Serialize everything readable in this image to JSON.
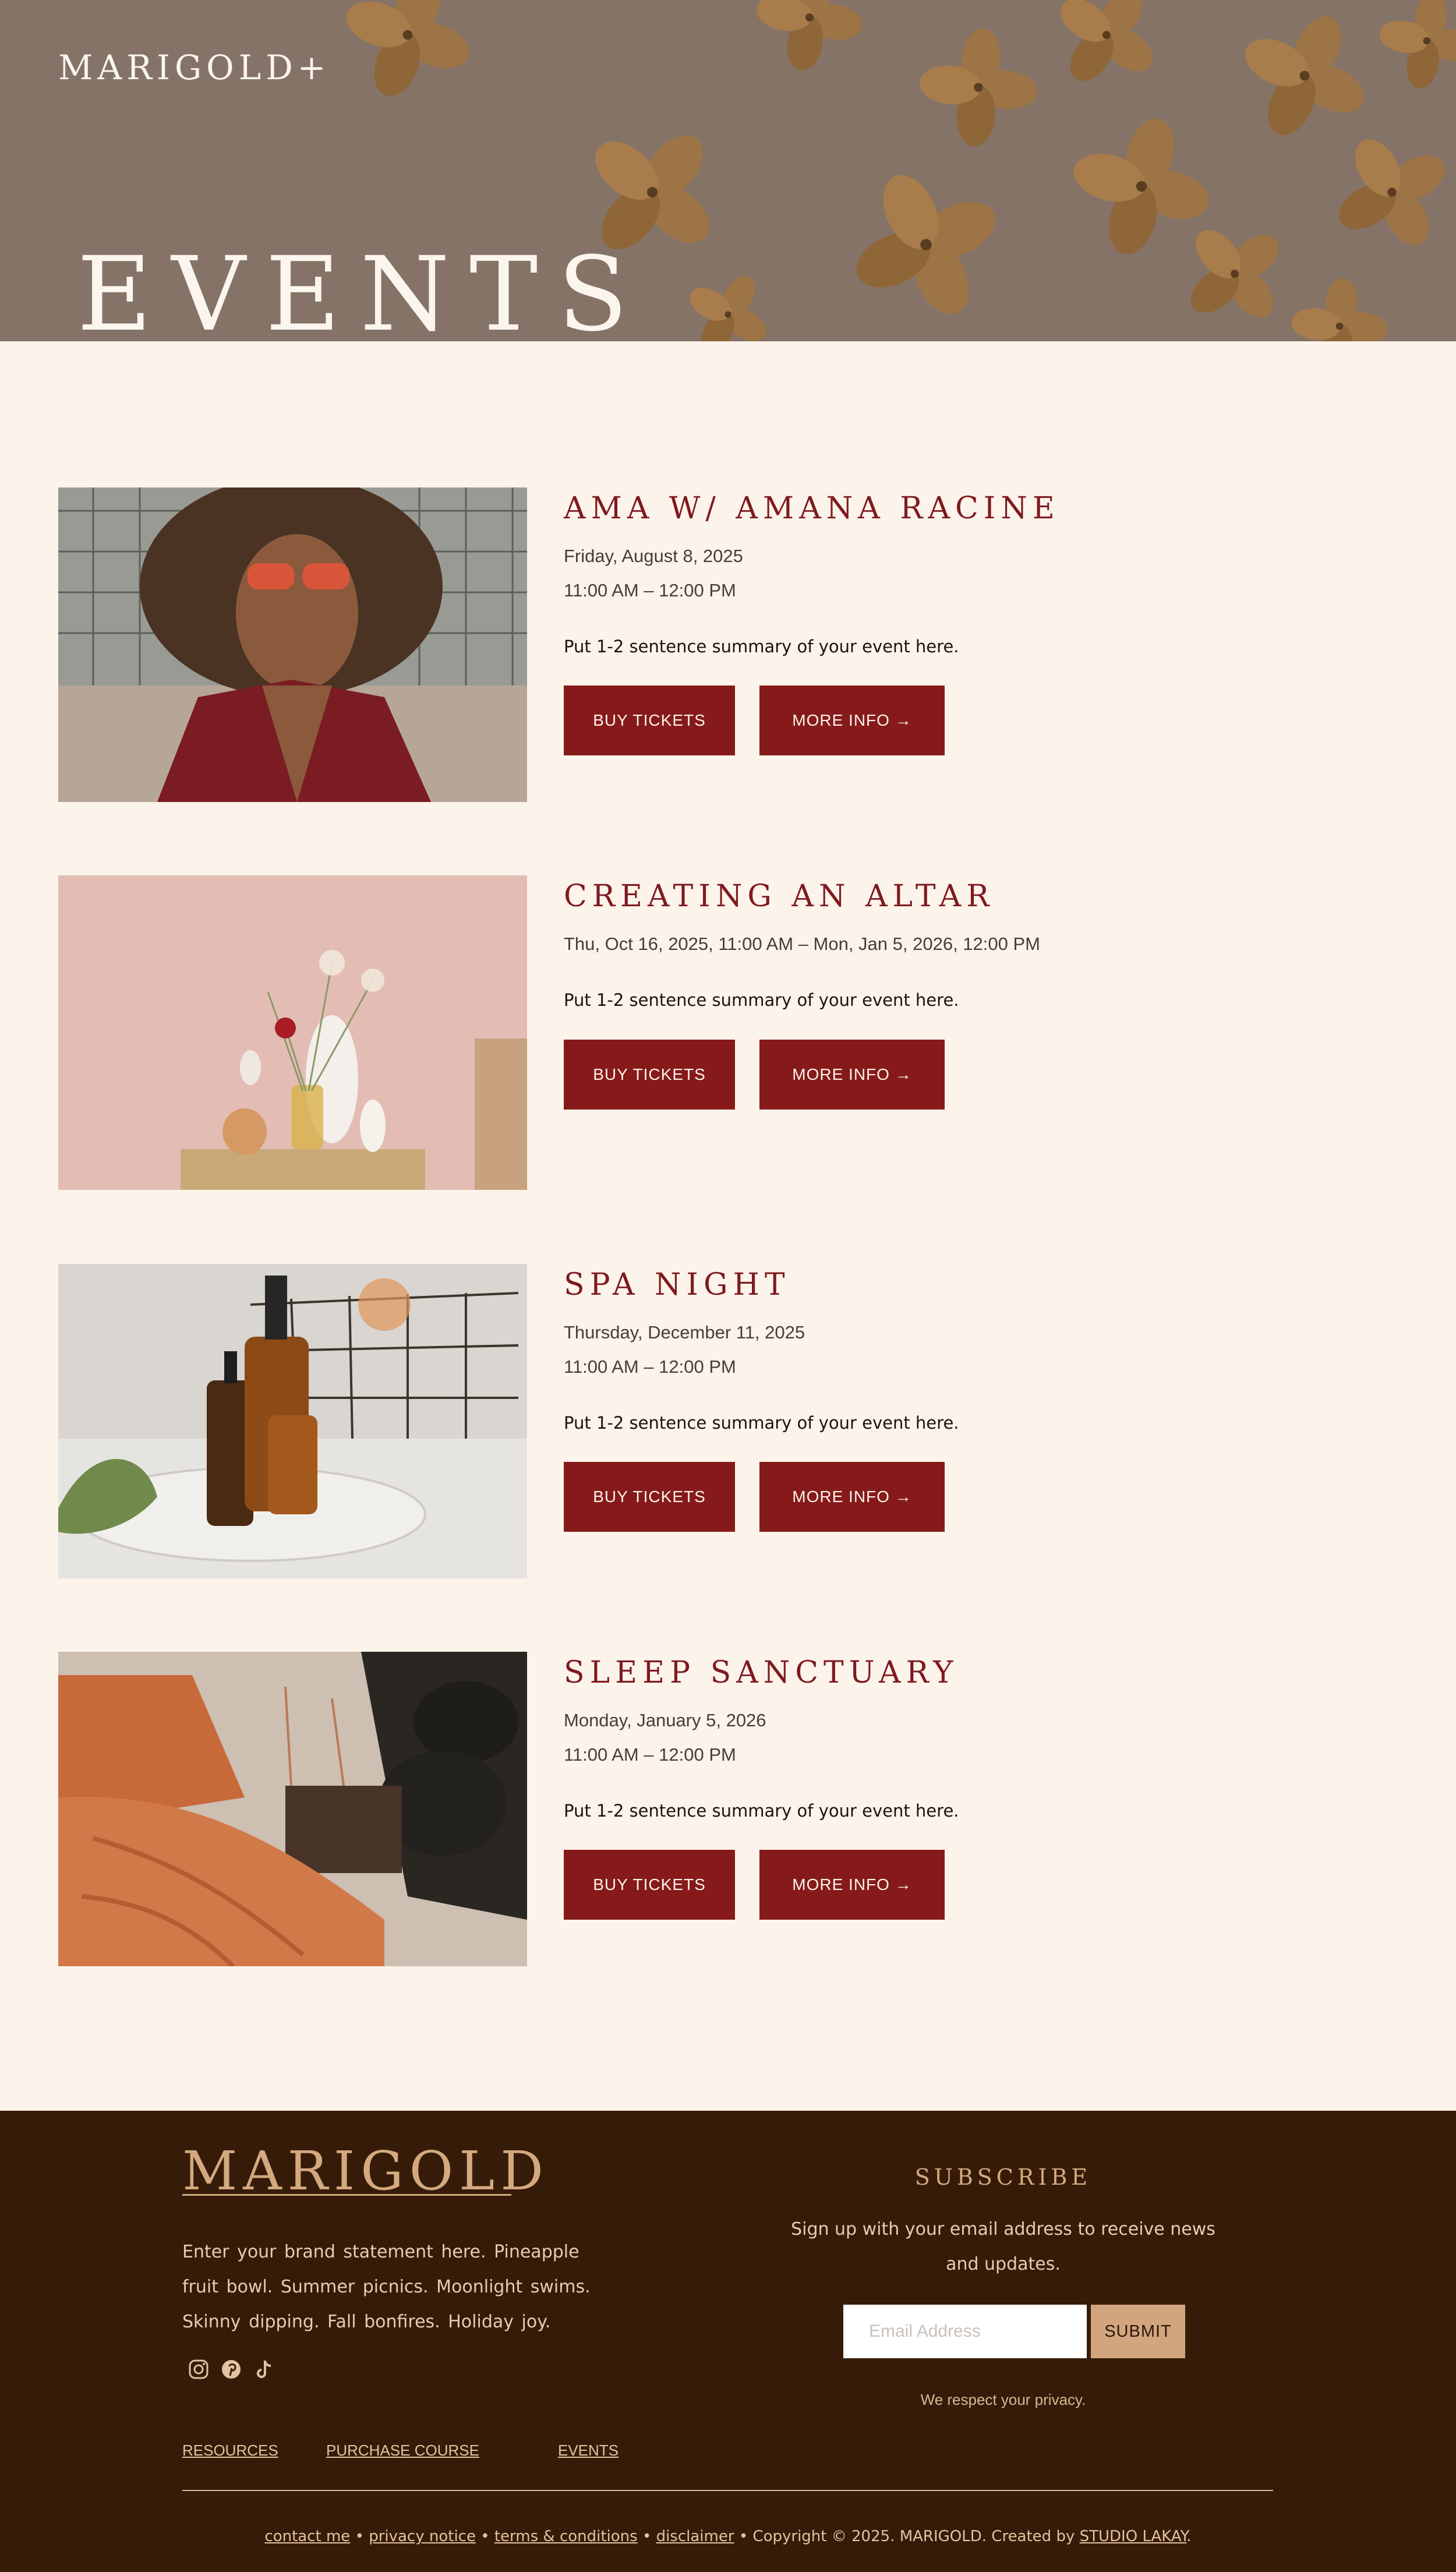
{
  "header": {
    "logo": "MARIGOLD+",
    "page_title": "EVENTS"
  },
  "events": [
    {
      "title": "AMA W/ AMANA RACINE",
      "date_line_1": "Friday, August 8, 2025",
      "date_line_2": "11:00 AM – 12:00 PM",
      "summary": "Put 1-2 sentence summary of your event here.",
      "buy_label": "BUY TICKETS",
      "more_label": "MORE INFO →"
    },
    {
      "title": "CREATING AN ALTAR",
      "date_line_1": "Thu, Oct 16, 2025, 11:00 AM – Mon, Jan 5, 2026, 12:00 PM",
      "summary": "Put 1-2 sentence summary of your event here.",
      "buy_label": "BUY TICKETS",
      "more_label": "MORE INFO →"
    },
    {
      "title": "SPA NIGHT",
      "date_line_1": "Thursday, December 11, 2025",
      "date_line_2": "11:00 AM – 12:00 PM",
      "summary": "Put 1-2 sentence summary of your event here.",
      "buy_label": "BUY TICKETS",
      "more_label": "MORE INFO →"
    },
    {
      "title": "SLEEP SANCTUARY",
      "date_line_1": "Monday, January 5, 2026",
      "date_line_2": "11:00 AM – 12:00 PM",
      "summary": "Put 1-2 sentence summary of your event here.",
      "buy_label": "BUY TICKETS",
      "more_label": "MORE INFO →"
    }
  ],
  "footer": {
    "logo": "MARIGOLD",
    "statement": "Enter your brand statement here.  Pineapple fruit bowl.  Summer picnics.   Moonlight swims.  Skinny dipping.  Fall bonfires.  Holiday joy.",
    "social_icons": [
      "instagram-icon",
      "pinterest-icon",
      "tiktok-icon"
    ],
    "subscribe_title": "SUBSCRIBE",
    "subscribe_text": "Sign up with your email address to receive news and updates.",
    "email_placeholder": "Email Address",
    "submit_label": "SUBMIT",
    "privacy_note": "We respect your privacy.",
    "links": [
      "RESOURCES",
      "PURCHASE COURSE",
      "EVENTS"
    ],
    "legal": {
      "contact": "contact me",
      "privacy": "privacy notice",
      "terms": "terms & conditions",
      "disclaimer": "disclaimer",
      "copyright": "Copyright © 2025.  MARIGOLD.  Created by",
      "studio": "STUDIO LAKAY",
      "separator": "•"
    }
  },
  "colors": {
    "background": "#fcf3ea",
    "accent": "#861a1a",
    "title": "#7e1a1f",
    "footer_bg": "#361c08",
    "footer_gold": "#d4a980",
    "submit_bg": "#d2a57f"
  }
}
